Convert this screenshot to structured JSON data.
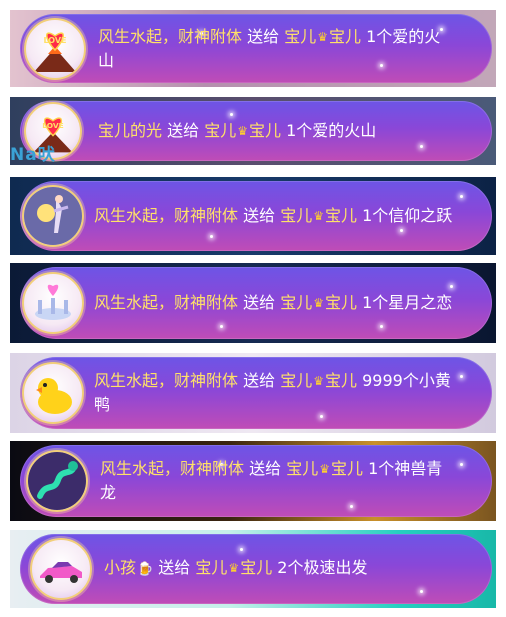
{
  "notifications": [
    {
      "sender": "风生水起，财神附体",
      "action": "送给",
      "recipient_a": "宝儿",
      "crown_icon": "crown-icon",
      "recipient_b": "宝儿",
      "gift": "1个爱的火山",
      "avatar_icon": "love-volcano-icon"
    },
    {
      "sender": "宝儿的光",
      "action": "送给",
      "recipient_a": "宝儿",
      "crown_icon": "crown-icon",
      "recipient_b": "宝儿",
      "gift": "1个爱的火山",
      "avatar_icon": "love-volcano-icon",
      "overlay_text": "Na吠"
    },
    {
      "sender": "风生水起，财神附体",
      "action": "送给",
      "recipient_a": "宝儿",
      "crown_icon": "crown-icon",
      "recipient_b": "宝儿",
      "gift": "1个信仰之跃",
      "avatar_icon": "leap-of-faith-icon"
    },
    {
      "sender": "风生水起，财神附体",
      "action": "送给",
      "recipient_a": "宝儿",
      "crown_icon": "crown-icon",
      "recipient_b": "宝儿",
      "gift": "1个星月之恋",
      "avatar_icon": "star-moon-love-icon"
    },
    {
      "sender": "风生水起，财神附体",
      "action": "送给",
      "recipient_a": "宝儿",
      "crown_icon": "crown-icon",
      "recipient_b": "宝儿",
      "gift": "9999个小黄鸭",
      "avatar_icon": "yellow-duck-icon"
    },
    {
      "sender": "风生水起，财神附体",
      "action": "送给",
      "recipient_a": "宝儿",
      "crown_icon": "crown-icon",
      "recipient_b": "宝儿",
      "gift": "1个神兽青龙",
      "avatar_icon": "azure-dragon-icon"
    },
    {
      "sender": "小孩",
      "sender_icon": "beer-icon",
      "action": "送给",
      "recipient_a": "宝儿",
      "crown_icon": "crown-icon",
      "recipient_b": "宝儿",
      "gift": "2个极速出发",
      "avatar_icon": "sports-car-icon"
    }
  ],
  "colors": {
    "sender": "#ffe168",
    "text": "#ffffff",
    "pill_top": "#6d55e6",
    "pill_bottom": "#c04cb6"
  }
}
